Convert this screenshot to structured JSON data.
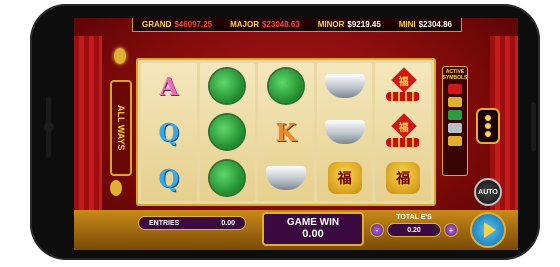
{
  "jackpots": [
    {
      "label": "GRAND",
      "value": "$46097.25"
    },
    {
      "label": "MAJOR",
      "value": "$23048.63"
    },
    {
      "label": "MINOR",
      "value": "$9219.45"
    },
    {
      "label": "MINI",
      "value": "$2304.86"
    }
  ],
  "side_panel": {
    "label": "ALL WAYS"
  },
  "active_symbols": {
    "title": "ACTIVE SYMBOLS"
  },
  "reels": [
    [
      "A",
      "Q",
      "Q"
    ],
    [
      "jade",
      "jade",
      "jade"
    ],
    [
      "jade",
      "K",
      "ingot"
    ],
    [
      "ingot",
      "ingot",
      "gold-pouch"
    ],
    [
      "firecracker",
      "firecracker",
      "gold-pouch"
    ]
  ],
  "pouch_glyph": "福",
  "firecracker_glyph": "福",
  "entries": {
    "label": "ENTRIES",
    "value": "0.00"
  },
  "game_win": {
    "label": "GAME WIN",
    "value": "0.00"
  },
  "total": {
    "label": "TOTAL E'S",
    "value": "0.20",
    "minus": "-",
    "plus": "+"
  },
  "auto": {
    "label": "AUTO"
  },
  "colors": {
    "accent_gold": "#e0b032",
    "jackpot_red": "#ff4747",
    "panel_purple": "#3a0a40"
  }
}
